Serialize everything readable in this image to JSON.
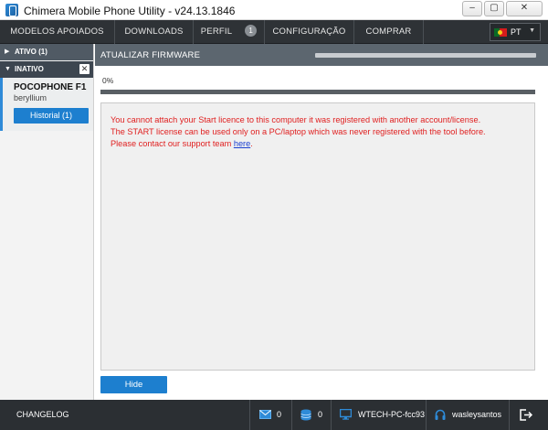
{
  "window": {
    "title": "Chimera Mobile Phone Utility - v24.13.1846",
    "minimize_glyph": "–",
    "maximize_glyph": "▢",
    "close_glyph": "✕"
  },
  "nav": {
    "items": [
      "MODELOS APOIADOS",
      "DOWNLOADS",
      "PERFIL",
      "CONFIGURAÇÃO",
      "COMPRAR"
    ],
    "perfil_badge": "1",
    "language": "PT"
  },
  "sidebar": {
    "active_group": "ATIVO (1)",
    "inactive_group": "INATIVO",
    "close_glyph": "✕",
    "device": {
      "name": "POCOPHONE F1",
      "codename": "beryllium",
      "history_label": "Historial (1)"
    }
  },
  "main": {
    "section_title": "ATUALIZAR FIRMWARE",
    "progress_text": "0%",
    "progress_value": 0,
    "message_line1": "You cannot attach your Start licence to this computer it was registered with another account/license.",
    "message_line2": "The START license can be used only on a PC/laptop which was never registered with the tool before.",
    "message_line3_prefix": "Please contact our support team ",
    "message_link": "here",
    "message_line3_suffix": ".",
    "hide_button": "Hide"
  },
  "statusbar": {
    "changelog": "CHANGELOG",
    "messages_count": "0",
    "queue_count": "0",
    "pc_name": "WTECH-PC-fcc93",
    "username": "wasleysantos"
  },
  "colors": {
    "accent": "#1d7fcf",
    "error_text": "#e02020",
    "nav_bg": "#2e3236",
    "panel_header": "#5c666f"
  },
  "icons": {
    "app": "chimera-app-icon",
    "flag": "portugal-flag-icon",
    "mail": "envelope-icon",
    "queue": "database-icon",
    "pc": "monitor-icon",
    "user": "headset-icon",
    "logout": "logout-icon"
  }
}
